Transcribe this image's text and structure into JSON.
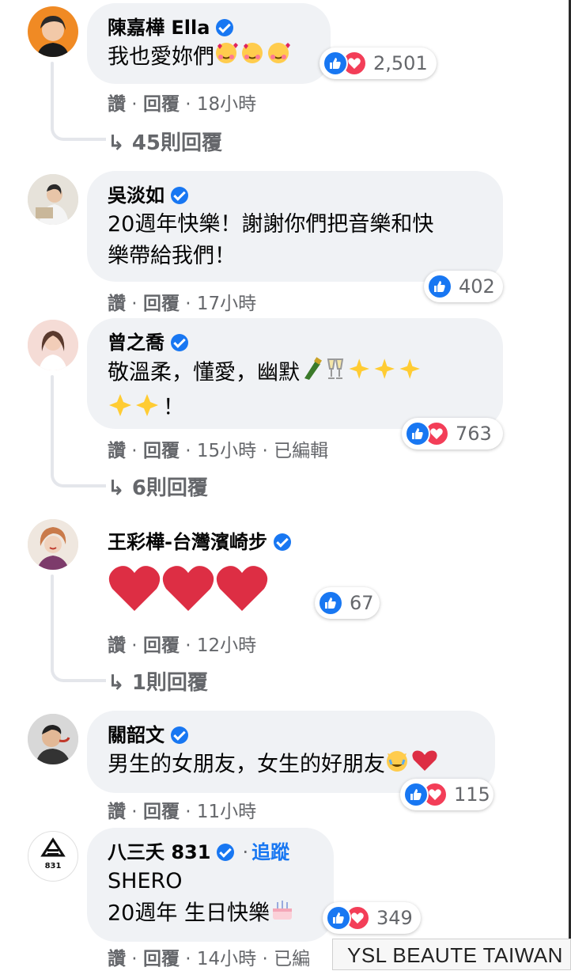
{
  "comments": [
    {
      "author": "陳嘉樺 Ella",
      "text": "我也愛妳們",
      "reaction_count": "2,501",
      "like": "讚",
      "reply": "回覆",
      "time": "18小時",
      "replies": "45則回覆"
    },
    {
      "author": "吳淡如",
      "text_line1": "20週年快樂！謝謝你們把音樂和快",
      "text_line2": "樂帶給我們！",
      "reaction_count": "402",
      "like": "讚",
      "reply": "回覆",
      "time": "17小時"
    },
    {
      "author": "曾之喬",
      "text_line1": "敬溫柔，懂愛，幽默",
      "text_line2": "！",
      "reaction_count": "763",
      "like": "讚",
      "reply": "回覆",
      "time": "15小時",
      "edited": "已編輯",
      "replies": "6則回覆"
    },
    {
      "author": "王彩樺-台灣濱崎步",
      "reaction_count": "67",
      "like": "讚",
      "reply": "回覆",
      "time": "12小時",
      "replies": "1則回覆"
    },
    {
      "author": "關韶文",
      "text": "男生的女朋友，女生的好朋友",
      "reaction_count": "115",
      "like": "讚",
      "reply": "回覆",
      "time": "11小時"
    },
    {
      "author": "八三夭 831",
      "follow": "追蹤",
      "text_line1": "SHERO",
      "text_line2": "20週年 生日快樂",
      "reaction_count": "349",
      "like": "讚",
      "reply": "回覆",
      "time": "14小時",
      "edited_partial": "已編",
      "avatar_logo": "831"
    }
  ],
  "tooltip": "YSL BEAUTE TAIWAN",
  "colors": {
    "bubble": "#f0f2f5",
    "like": "#1877f2",
    "love": "#f33e58",
    "meta": "#65676b"
  }
}
